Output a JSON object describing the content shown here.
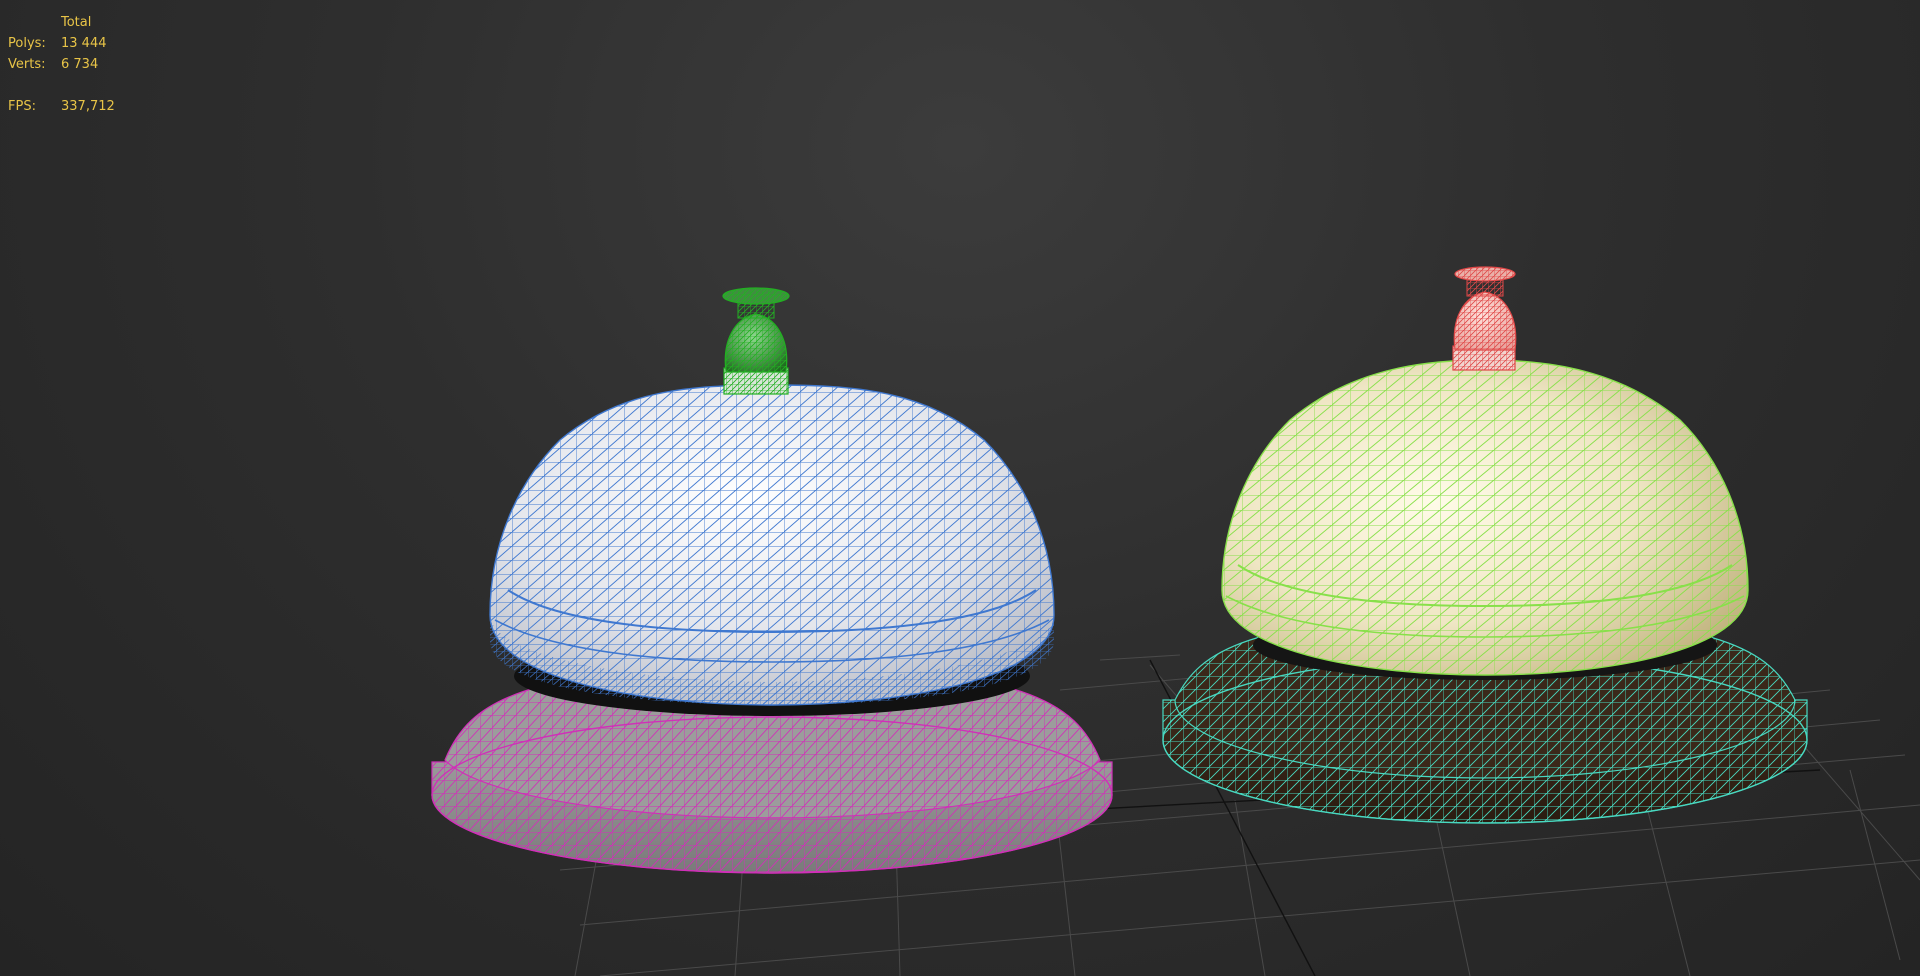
{
  "stats": {
    "header": "Total",
    "polys_label": "Polys:",
    "polys_value": "13 444",
    "verts_label": "Verts:",
    "verts_value": "6 734",
    "fps_label": "FPS:",
    "fps_value": "337,712"
  },
  "colors": {
    "background": "#2e2e2e",
    "grid": "#4a4a4a",
    "stats_text": "#e8c447",
    "left_dome_wire": "#3f78d0",
    "left_knob_wire": "#22b022",
    "left_base_wire": "#d030b8",
    "right_dome_wire": "#88e04a",
    "right_knob_wire": "#e04848",
    "right_base_wire": "#48d8c0"
  },
  "objects": [
    {
      "name": "Bell dome (left)",
      "wire_color": "#3f78d0"
    },
    {
      "name": "Bell plunger (left)",
      "wire_color": "#22b022"
    },
    {
      "name": "Bell base (left)",
      "wire_color": "#d030b8"
    },
    {
      "name": "Bell dome (right)",
      "wire_color": "#88e04a"
    },
    {
      "name": "Bell plunger (right)",
      "wire_color": "#e04848"
    },
    {
      "name": "Bell base (right)",
      "wire_color": "#48d8c0"
    }
  ]
}
